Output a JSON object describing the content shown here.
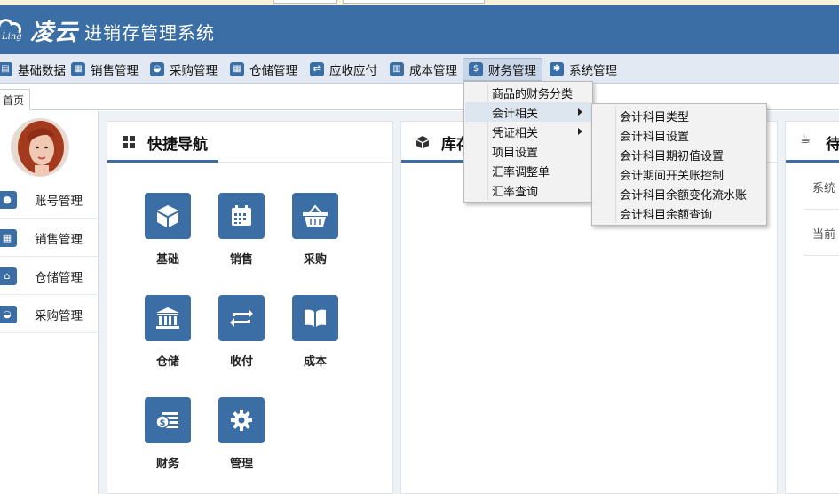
{
  "app": {
    "logo_small": "Ling",
    "logo_cn": "凌云",
    "title": "进销存管理系统"
  },
  "menu": [
    {
      "label": "基础数据",
      "icon": "database-icon"
    },
    {
      "label": "销售管理",
      "icon": "calendar-icon"
    },
    {
      "label": "采购管理",
      "icon": "basket-icon"
    },
    {
      "label": "仓储管理",
      "icon": "calendar-icon"
    },
    {
      "label": "应收应付",
      "icon": "exchange-icon"
    },
    {
      "label": "成本管理",
      "icon": "book-icon"
    },
    {
      "label": "财务管理",
      "icon": "money-icon"
    },
    {
      "label": "系统管理",
      "icon": "gear-icon"
    }
  ],
  "tabs": {
    "home": "首页"
  },
  "sidebar": {
    "items": [
      {
        "label": "账号管理",
        "icon": "user-icon"
      },
      {
        "label": "销售管理",
        "icon": "calendar-icon"
      },
      {
        "label": "仓储管理",
        "icon": "bank-icon"
      },
      {
        "label": "采购管理",
        "icon": "basket-icon"
      }
    ]
  },
  "quicknav": {
    "title": "快捷导航",
    "tiles": [
      {
        "label": "基础",
        "icon": "cube-icon"
      },
      {
        "label": "销售",
        "icon": "calendar-icon"
      },
      {
        "label": "采购",
        "icon": "basket-icon"
      },
      {
        "label": "仓储",
        "icon": "bank-icon"
      },
      {
        "label": "收付",
        "icon": "exchange-icon"
      },
      {
        "label": "成本",
        "icon": "book-icon"
      },
      {
        "label": "财务",
        "icon": "money-icon"
      },
      {
        "label": "管理",
        "icon": "gear-icon"
      }
    ]
  },
  "inventory_panel": {
    "title": "库存"
  },
  "todo_panel": {
    "title": "待",
    "rows": [
      "系统",
      "当前"
    ]
  },
  "finance_menu": {
    "items": [
      {
        "label": "商品的财务分类",
        "has_sub": false
      },
      {
        "label": "会计相关",
        "has_sub": true
      },
      {
        "label": "凭证相关",
        "has_sub": true
      },
      {
        "label": "项目设置",
        "has_sub": false
      },
      {
        "label": "汇率调整单",
        "has_sub": false
      },
      {
        "label": "汇率查询",
        "has_sub": false
      }
    ]
  },
  "accounting_submenu": {
    "items": [
      "会计科目类型",
      "会计科目设置",
      "会计科目期初值设置",
      "会计期间开关账控制",
      "会计科目余额变化流水账",
      "会计科目余额查询"
    ]
  },
  "colors": {
    "brand": "#3a6ea5",
    "menubar": "#e2e9f3"
  }
}
